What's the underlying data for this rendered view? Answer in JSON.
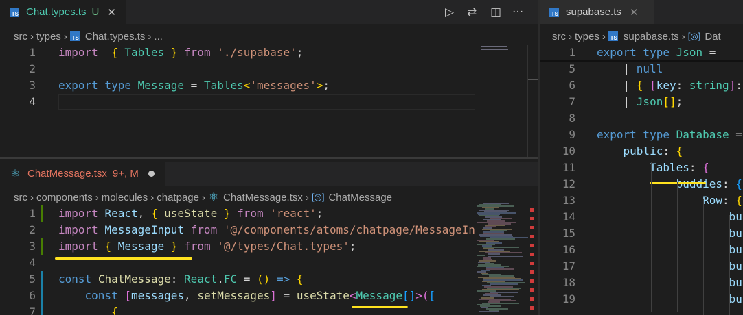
{
  "top_editor": {
    "tab": {
      "icon": "ts-icon",
      "name": "Chat.types.ts",
      "status": "U"
    },
    "breadcrumb": [
      "src",
      "types",
      "Chat.types.ts",
      "..."
    ],
    "actions": [
      "run-icon",
      "compare-changes-icon",
      "split-editor-icon",
      "more-icon"
    ],
    "lines": [
      {
        "n": "1",
        "tokens": [
          [
            "kw2",
            "import"
          ],
          [
            "",
            "  "
          ],
          [
            "br1",
            "{"
          ],
          [
            "",
            ""
          ],
          [
            "ty",
            " Tables "
          ],
          [
            "br1",
            "}"
          ],
          [
            "kw2",
            " from "
          ],
          [
            "st",
            "'./supabase'"
          ],
          [
            "",
            ";"
          ]
        ]
      },
      {
        "n": "2",
        "tokens": []
      },
      {
        "n": "3",
        "tokens": [
          [
            "kw",
            "export"
          ],
          [
            "kw",
            " type "
          ],
          [
            "ty",
            "Message"
          ],
          [
            "",
            " = "
          ],
          [
            "ty",
            "Tables"
          ],
          [
            "br1",
            "<"
          ],
          [
            "st",
            "'messages'"
          ],
          [
            "br1",
            ">"
          ],
          [
            "",
            ";"
          ]
        ]
      },
      {
        "n": "4",
        "tokens": []
      }
    ]
  },
  "bottom_editor": {
    "tab": {
      "icon": "react-icon",
      "name": "ChatMessage.tsx",
      "status": "9+, M"
    },
    "breadcrumb": [
      "src",
      "components",
      "molecules",
      "chatpage",
      "ChatMessage.tsx",
      "ChatMessage"
    ],
    "lines": [
      {
        "n": "1",
        "tokens": [
          [
            "kw2",
            "import"
          ],
          [
            "",
            " "
          ],
          [
            "vr",
            "React"
          ],
          [
            "",
            ", "
          ],
          [
            "br1",
            "{"
          ],
          [
            "",
            " "
          ],
          [
            "fn",
            "useState"
          ],
          [
            "",
            " "
          ],
          [
            "br1",
            "}"
          ],
          [
            "kw2",
            " from "
          ],
          [
            "st",
            "'react'"
          ],
          [
            "",
            ";"
          ]
        ]
      },
      {
        "n": "2",
        "tokens": [
          [
            "kw2",
            "import"
          ],
          [
            "",
            " "
          ],
          [
            "vr",
            "MessageInput"
          ],
          [
            "kw2",
            " from "
          ],
          [
            "st",
            "'@/components/atoms/chatpage/MessageIn"
          ]
        ]
      },
      {
        "n": "3",
        "tokens": [
          [
            "kw2",
            "import"
          ],
          [
            "",
            " "
          ],
          [
            "br1",
            "{"
          ],
          [
            "",
            " "
          ],
          [
            "vr",
            "Message"
          ],
          [
            "",
            " "
          ],
          [
            "br1",
            "}"
          ],
          [
            "kw2",
            " from "
          ],
          [
            "st",
            "'@/types/Chat.types'"
          ],
          [
            "",
            ";"
          ]
        ]
      },
      {
        "n": "4",
        "tokens": []
      },
      {
        "n": "5",
        "tokens": [
          [
            "kw",
            "const"
          ],
          [
            "",
            " "
          ],
          [
            "fn",
            "ChatMessage"
          ],
          [
            "",
            ": "
          ],
          [
            "ty",
            "React"
          ],
          [
            "",
            "."
          ],
          [
            "ty",
            "FC"
          ],
          [
            "",
            " = "
          ],
          [
            "br1",
            "()"
          ],
          [
            "",
            " "
          ],
          [
            "kw",
            "=>"
          ],
          [
            "",
            " "
          ],
          [
            "br1",
            "{"
          ]
        ]
      },
      {
        "n": "6",
        "tokens": [
          [
            "",
            "    "
          ],
          [
            "kw",
            "const"
          ],
          [
            "",
            " "
          ],
          [
            "br2",
            "["
          ],
          [
            "vr",
            "messages"
          ],
          [
            "",
            ", "
          ],
          [
            "fn",
            "setMessages"
          ],
          [
            "br2",
            "]"
          ],
          [
            "",
            " = "
          ],
          [
            "fn",
            "useState"
          ],
          [
            "br2",
            "<"
          ],
          [
            "ty",
            "Message"
          ],
          [
            "br3",
            "[]"
          ],
          [
            "br2",
            ">"
          ],
          [
            "br2",
            "("
          ],
          [
            "br3",
            "["
          ]
        ]
      },
      {
        "n": "7",
        "tokens": [
          [
            "",
            "        "
          ],
          [
            "br1",
            "{"
          ]
        ]
      }
    ]
  },
  "right_editor": {
    "tab": {
      "icon": "ts-icon",
      "name": "supabase.ts"
    },
    "breadcrumb": [
      "src",
      "types",
      "supabase.ts",
      "Dat"
    ],
    "lines": [
      {
        "n": "1",
        "tokens": [
          [
            "kw",
            "export"
          ],
          [
            "kw",
            " type "
          ],
          [
            "ty",
            "Json"
          ],
          [
            "",
            " ="
          ]
        ]
      },
      {
        "n": "5",
        "tokens": [
          [
            "",
            "    | "
          ],
          [
            "kw",
            "null"
          ]
        ]
      },
      {
        "n": "6",
        "tokens": [
          [
            "",
            "    | "
          ],
          [
            "br1",
            "{"
          ],
          [
            "",
            " "
          ],
          [
            "br2",
            "["
          ],
          [
            "vr",
            "key"
          ],
          [
            "",
            ": "
          ],
          [
            "ty",
            "string"
          ],
          [
            "br2",
            "]"
          ],
          [
            "",
            ":"
          ]
        ]
      },
      {
        "n": "7",
        "tokens": [
          [
            "",
            "    | "
          ],
          [
            "ty",
            "Json"
          ],
          [
            "br1",
            "[]"
          ],
          [
            "",
            ";"
          ]
        ]
      },
      {
        "n": "8",
        "tokens": []
      },
      {
        "n": "9",
        "tokens": [
          [
            "kw",
            "export"
          ],
          [
            "kw",
            " type "
          ],
          [
            "ty",
            "Database"
          ],
          [
            "",
            " ="
          ]
        ]
      },
      {
        "n": "10",
        "tokens": [
          [
            "",
            "    "
          ],
          [
            "vr",
            "public"
          ],
          [
            "",
            ": "
          ],
          [
            "br1",
            "{"
          ]
        ]
      },
      {
        "n": "11",
        "tokens": [
          [
            "",
            "        "
          ],
          [
            "vr",
            "Tables"
          ],
          [
            "",
            ": "
          ],
          [
            "br2",
            "{"
          ]
        ]
      },
      {
        "n": "12",
        "tokens": [
          [
            "",
            "            "
          ],
          [
            "vr",
            "buddies"
          ],
          [
            "",
            ": "
          ],
          [
            "br3",
            "{"
          ]
        ]
      },
      {
        "n": "13",
        "tokens": [
          [
            "",
            "                "
          ],
          [
            "vr",
            "Row"
          ],
          [
            "",
            ": "
          ],
          [
            "br1",
            "{"
          ]
        ]
      },
      {
        "n": "14",
        "tokens": [
          [
            "",
            "                    "
          ],
          [
            "vr",
            "bu"
          ]
        ]
      },
      {
        "n": "15",
        "tokens": [
          [
            "",
            "                    "
          ],
          [
            "vr",
            "bu"
          ]
        ]
      },
      {
        "n": "16",
        "tokens": [
          [
            "",
            "                    "
          ],
          [
            "vr",
            "bu"
          ]
        ]
      },
      {
        "n": "17",
        "tokens": [
          [
            "",
            "                    "
          ],
          [
            "vr",
            "bu"
          ]
        ]
      },
      {
        "n": "18",
        "tokens": [
          [
            "",
            "                    "
          ],
          [
            "vr",
            "bu"
          ]
        ]
      },
      {
        "n": "19",
        "tokens": [
          [
            "",
            "                    "
          ],
          [
            "vr",
            "bu"
          ]
        ]
      }
    ]
  },
  "colors": {
    "underline": "#ffe21f",
    "modified_gutter": "#3f7a3f",
    "accent": "#3178c6"
  }
}
